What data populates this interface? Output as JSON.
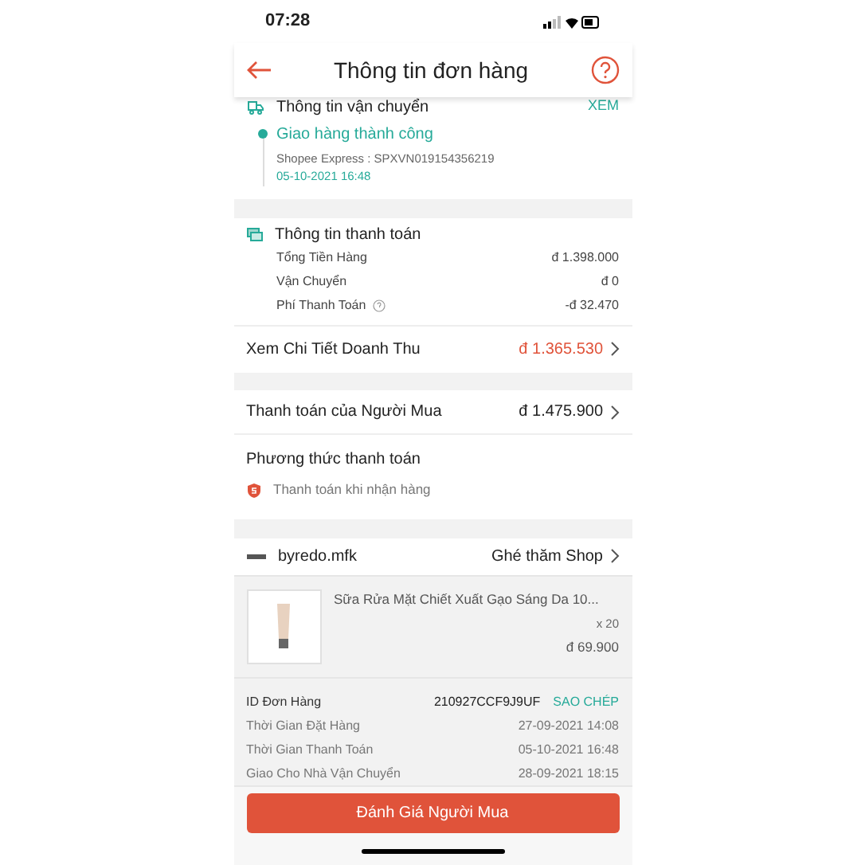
{
  "status_bar": {
    "time": "07:28"
  },
  "header": {
    "title": "Thông tin đơn hàng"
  },
  "shipping": {
    "title": "Thông tin vận chuyển",
    "action": "XEM",
    "status": "Giao hàng thành công",
    "carrier": "Shopee Express :  SPXVN019154356219",
    "time": "05-10-2021 16:48"
  },
  "payment_info": {
    "title": "Thông tin thanh toán",
    "rows": [
      {
        "label": "Tổng Tiền Hàng",
        "value": "đ 1.398.000",
        "help": false
      },
      {
        "label": "Vận Chuyển",
        "value": "đ 0",
        "help": false
      },
      {
        "label": "Phí Thanh Toán",
        "value": "-đ 32.470",
        "help": true
      }
    ],
    "revenue": {
      "label": "Xem Chi Tiết Doanh Thu",
      "value": "đ 1.365.530"
    }
  },
  "buyer_payment": {
    "label": "Thanh toán của Người Mua",
    "value": "đ 1.475.900"
  },
  "payment_method": {
    "title": "Phương thức thanh toán",
    "method": "Thanh toán khi nhận hàng"
  },
  "shop": {
    "name": "byredo.mfk",
    "action": "Ghé thăm Shop"
  },
  "product": {
    "name": "Sữa Rửa Mặt Chiết Xuất Gạo Sáng Da 10...",
    "quantity": "x 20",
    "price": "đ 69.900"
  },
  "order_details": [
    {
      "label": "ID Đơn Hàng",
      "value": "210927CCF9J9UF",
      "action": "SAO CHÉP"
    },
    {
      "label": "Thời Gian Đặt Hàng",
      "value": "27-09-2021 14:08"
    },
    {
      "label": "Thời Gian Thanh Toán",
      "value": "05-10-2021 16:48"
    },
    {
      "label": "Giao Cho Nhà Vận Chuyển",
      "value": "28-09-2021 18:15"
    }
  ],
  "button": "Đánh Giá Người Mua"
}
